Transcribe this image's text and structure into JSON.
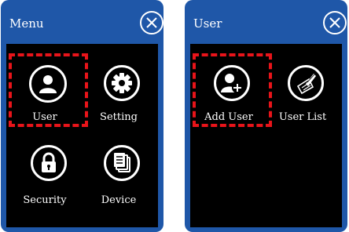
{
  "left_screen": {
    "title": "Menu",
    "tiles": [
      {
        "label": "User",
        "icon": "user-icon",
        "highlighted": true
      },
      {
        "label": "Setting",
        "icon": "gear-icon",
        "highlighted": false
      },
      {
        "label": "Security",
        "icon": "lock-icon",
        "highlighted": false
      },
      {
        "label": "Device",
        "icon": "documents-icon",
        "highlighted": false
      }
    ]
  },
  "right_screen": {
    "title": "User",
    "tiles": [
      {
        "label": "Add User",
        "icon": "add-user-icon",
        "highlighted": true
      },
      {
        "label": "User List",
        "icon": "user-list-icon",
        "highlighted": false
      }
    ]
  },
  "colors": {
    "panel_frame": "#1f57a8",
    "content_bg": "#000000",
    "highlight": "#e8141a",
    "text": "#ffffff"
  }
}
